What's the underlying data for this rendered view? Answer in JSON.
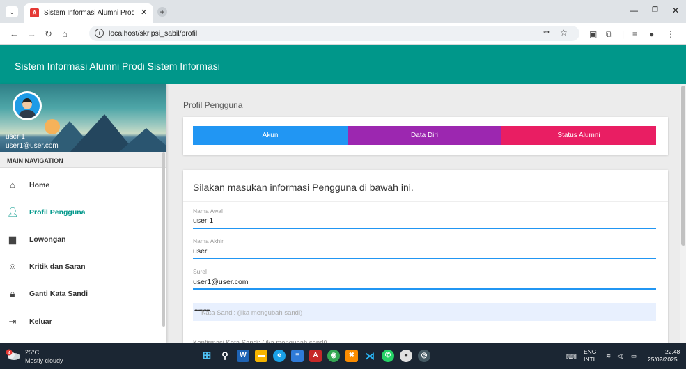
{
  "browser": {
    "tab_title": "Sistem Informasi Alumni Prodi S",
    "tab_close": "✕",
    "new_tab": "+",
    "url": "localhost/skripsi_sabil/profil"
  },
  "app": {
    "title": "Sistem Informasi Alumni Prodi Sistem Informasi"
  },
  "sidebar": {
    "user_name": "user 1",
    "user_email": "user1@user.com",
    "nav_header": "MAIN NAVIGATION",
    "items": [
      {
        "label": "Home",
        "icon": "home-icon",
        "active": false
      },
      {
        "label": "Profil Pengguna",
        "icon": "person-icon",
        "active": true
      },
      {
        "label": "Lowongan",
        "icon": "briefcase-icon",
        "active": false
      },
      {
        "label": "Kritik dan Saran",
        "icon": "smiley-icon",
        "active": false
      },
      {
        "label": "Ganti Kata Sandi",
        "icon": "lock-icon",
        "active": false
      },
      {
        "label": "Keluar",
        "icon": "logout-icon",
        "active": false
      }
    ]
  },
  "main": {
    "page_title": "Profil Pengguna",
    "tabs": [
      {
        "label": "Akun",
        "color": "#2196f3"
      },
      {
        "label": "Data Diri",
        "color": "#9c27b0"
      },
      {
        "label": "Status Alumni",
        "color": "#e91e63"
      }
    ],
    "form": {
      "heading": "Silakan masukan informasi Pengguna di bawah ini.",
      "first_name_label": "Nama Awal",
      "first_name_value": "user 1",
      "last_name_label": "Nama Akhir",
      "last_name_value": "user",
      "email_label": "Surel",
      "email_value": "user1@user.com",
      "password_dots": "••••••••••",
      "password_placeholder": "Kata Sandi: (jika mengubah sandi)",
      "confirm_label": "Konfirmasi Kata Sandi: (jika mengubah sandi)"
    }
  },
  "taskbar": {
    "weather_temp": "25°C",
    "weather_desc": "Mostly cloudy",
    "weather_badge": "4",
    "lang_top": "ENG",
    "lang_bottom": "INTL",
    "time": "22.48",
    "date": "25/02/2025"
  },
  "colors": {
    "header": "#00978a",
    "accent": "#2196f3"
  }
}
